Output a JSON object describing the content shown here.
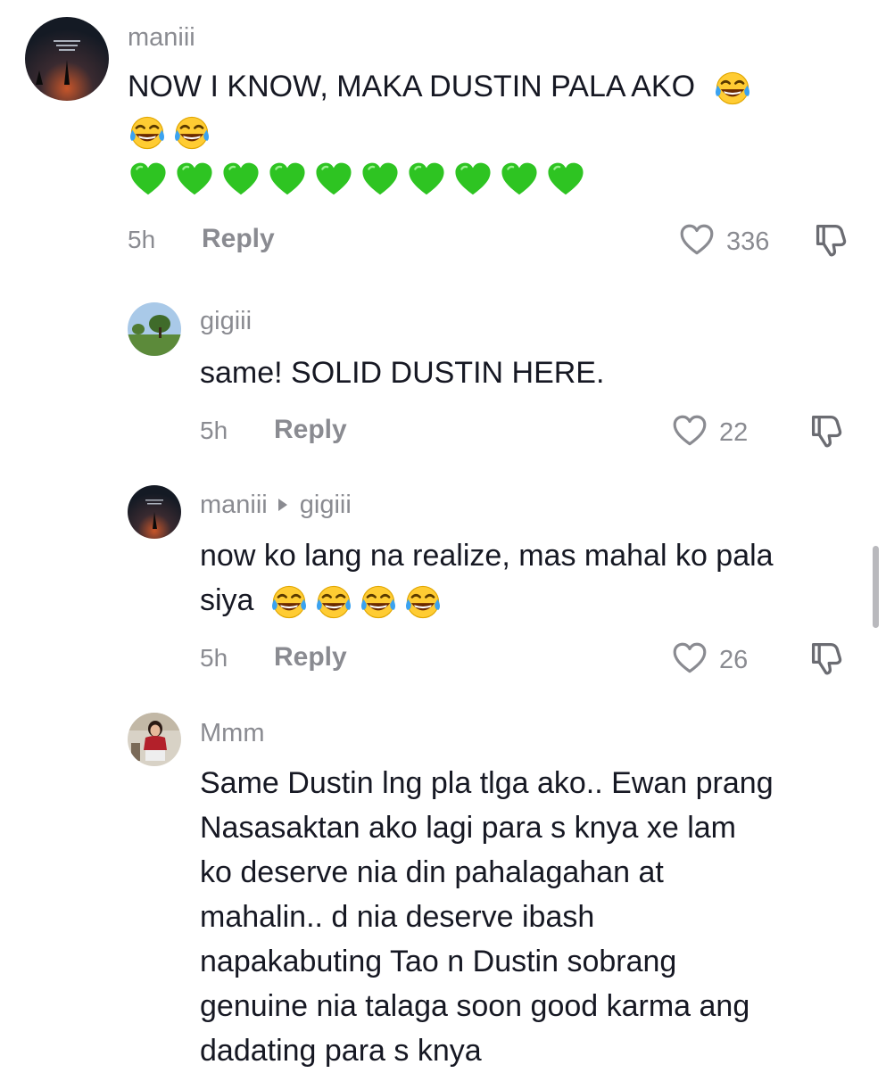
{
  "comments": [
    {
      "username": "maniii",
      "text": "NOW I KNOW, MAKA DUSTIN PALA AKO",
      "time": "5h",
      "reply_label": "Reply",
      "likes": "336",
      "laugh_emoji_count": 3,
      "green_heart_count": 10
    },
    {
      "username": "gigiii",
      "text": "same! SOLID DUSTIN HERE.",
      "time": "5h",
      "reply_label": "Reply",
      "likes": "22"
    },
    {
      "username": "maniii",
      "reply_to": "gigiii",
      "text_line1": "now ko lang na realize, mas mahal ko pala",
      "text_line2": "siya",
      "time": "5h",
      "reply_label": "Reply",
      "likes": "26",
      "laugh_emoji_count": 4
    },
    {
      "username": "Mmm",
      "lines": [
        "Same Dustin lng pla tlga ako.. Ewan prang",
        "Nasasaktan ako lagi para s knya xe lam",
        "ko deserve nia din pahalagahan at",
        "mahalin.. d nia deserve ibash",
        "napakabuting Tao n Dustin sobrang",
        "genuine nia talaga soon good karma ang",
        "dadating para s knya"
      ]
    }
  ],
  "icons": {
    "like": "heart-outline-icon",
    "dislike": "thumbs-down-icon",
    "laugh": "tears-of-joy-emoji",
    "heart": "green-heart-emoji",
    "reply_arrow": "play-triangle-icon"
  },
  "colors": {
    "text": "#161823",
    "muted": "#8a8b91",
    "green_heart": "#2ec422",
    "emoji_yellow": "#ffcc33"
  }
}
